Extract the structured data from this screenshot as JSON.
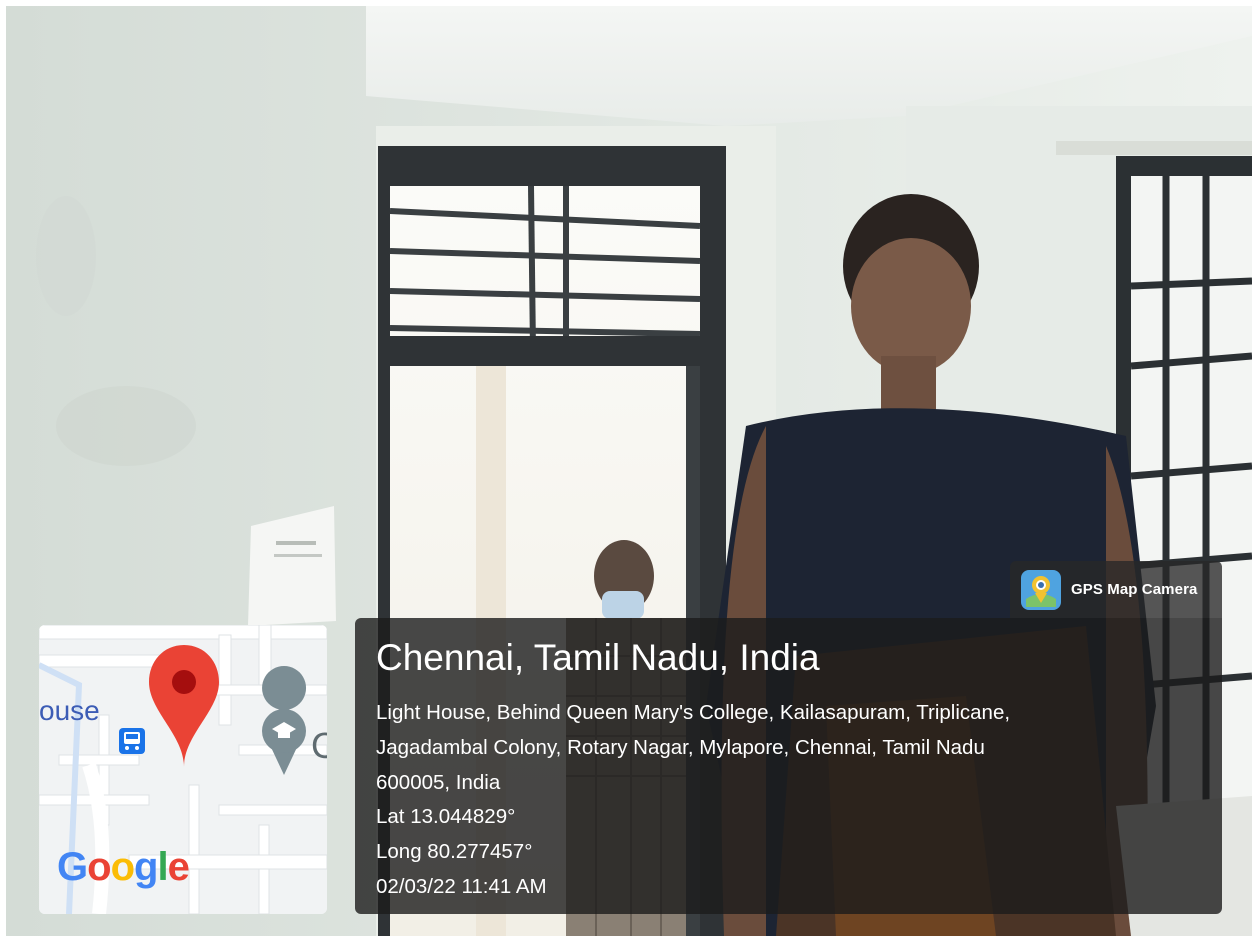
{
  "badge": {
    "label": "GPS Map Camera",
    "icon": "gps-map-camera-icon"
  },
  "location": {
    "title": "Chennai, Tamil Nadu, India",
    "address_line1": "Light House, Behind Queen Mary's College, Kailasapuram, Triplicane,",
    "address_line2": "Jagadambal Colony, Rotary Nagar, Mylapore, Chennai, Tamil Nadu",
    "address_line3": "600005, India",
    "lat": "Lat 13.044829°",
    "long": "Long 80.277457°",
    "datetime": "02/03/22 11:41 AM"
  },
  "map": {
    "place_fragment": "ouse",
    "edge_fragment": "C",
    "logo": [
      "G",
      "o",
      "o",
      "g",
      "l",
      "e"
    ],
    "pin_color": "#ea4335",
    "bus_icon": "bus-stop-icon",
    "school_icon": "school-pin-icon"
  },
  "colors": {
    "google_blue": "#4285f4",
    "google_red": "#ea4335",
    "google_yellow": "#fbbc05",
    "google_green": "#34a853"
  }
}
